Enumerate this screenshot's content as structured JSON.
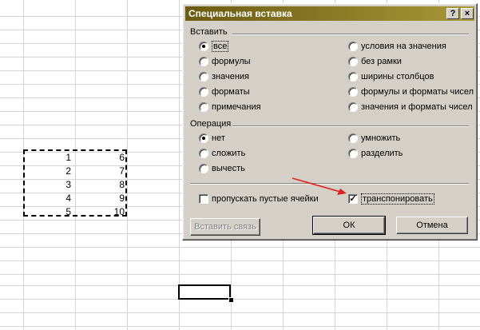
{
  "dialog": {
    "title": "Специальная вставка",
    "help_button": "?",
    "close_button": "×",
    "paste_group": {
      "label": "Вставить",
      "options_left": [
        "все",
        "формулы",
        "значения",
        "форматы",
        "примечания"
      ],
      "options_right": [
        "условия на значения",
        "без рамки",
        "ширины столбцов",
        "формулы и форматы чисел",
        "значения и форматы чисел"
      ],
      "selected": "все"
    },
    "operation_group": {
      "label": "Операция",
      "options_left": [
        "нет",
        "сложить",
        "вычесть"
      ],
      "options_right": [
        "умножить",
        "разделить"
      ],
      "selected": "нет"
    },
    "skip_blanks": {
      "label": "пропускать пустые ячейки",
      "checked": false
    },
    "transpose": {
      "label": "транспонировать",
      "checked": true
    },
    "buttons": {
      "paste_link": "Вставить связь",
      "ok": "ОК",
      "cancel": "Отмена"
    }
  },
  "spreadsheet": {
    "col_a": [
      "1",
      "2",
      "3",
      "4",
      "5"
    ],
    "col_b": [
      "6",
      "7",
      "8",
      "9",
      "10"
    ]
  },
  "colors": {
    "titlebar_start": "#6b5b12",
    "titlebar_end": "#a89838",
    "dialog_bg": "#d4d0c8",
    "annotation_arrow": "#e02020"
  }
}
